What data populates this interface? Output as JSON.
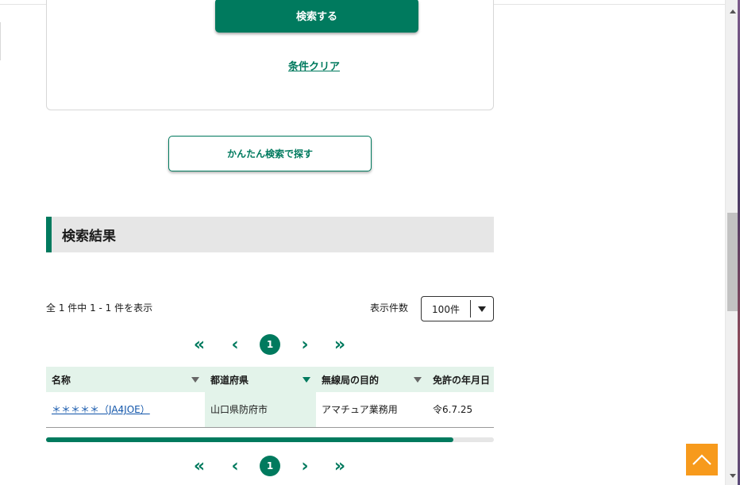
{
  "search_panel": {
    "search_button_label": "検索する",
    "clear_link_label": "条件クリア"
  },
  "easy_search_button_label": "かんたん検索で探す",
  "results": {
    "heading": "検索結果",
    "count_text": "全 1 件中 1 - 1 件を表示",
    "per_page_label": "表示件数",
    "per_page_value": "100件",
    "pager": {
      "first": "«",
      "prev": "‹",
      "current": "1",
      "next": "›",
      "last": "»"
    },
    "table": {
      "columns": [
        "名称",
        "都道府県",
        "無線局の目的",
        "免許の年月日"
      ],
      "rows": [
        {
          "name": "＊＊＊＊＊（JA4JOE）",
          "prefecture": "山口県防府市",
          "purpose": "アマチュア業務用",
          "license_date": "令6.7.25"
        }
      ]
    },
    "horizontal_scroll_position": 0.91
  },
  "icons": {
    "back_to_top": "chevron-up-icon",
    "select_caret": "caret-down-icon",
    "sort": "sort-down-icon"
  },
  "colors": {
    "accent": "#007a5e",
    "header_bg": "#e3f3ea",
    "back_to_top": "#f79a1c",
    "link": "#1155aa"
  }
}
